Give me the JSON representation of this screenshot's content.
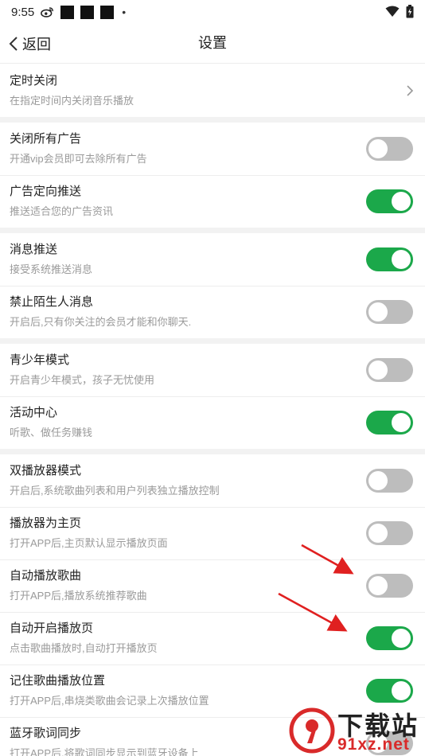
{
  "status_bar": {
    "time": "9:55"
  },
  "header": {
    "back_label": "返回",
    "title": "设置"
  },
  "settings": [
    {
      "label": "定时关闭",
      "desc": "在指定时间内关闭音乐播放",
      "control": "chevron"
    },
    {
      "separator": true
    },
    {
      "label": "关闭所有广告",
      "desc": "开通vip会员即可去除所有广告",
      "control": "toggle",
      "on": false
    },
    {
      "label": "广告定向推送",
      "desc": "推送适合您的广告资讯",
      "control": "toggle",
      "on": true
    },
    {
      "separator": true
    },
    {
      "label": "消息推送",
      "desc": "接受系统推送消息",
      "control": "toggle",
      "on": true
    },
    {
      "label": "禁止陌生人消息",
      "desc": "开启后,只有你关注的会员才能和你聊天.",
      "control": "toggle",
      "on": false
    },
    {
      "separator": true
    },
    {
      "label": "青少年模式",
      "desc": "开启青少年模式，孩子无忧使用",
      "control": "toggle",
      "on": false
    },
    {
      "label": "活动中心",
      "desc": "听歌、做任务赚钱",
      "control": "toggle",
      "on": true
    },
    {
      "separator": true
    },
    {
      "label": "双播放器模式",
      "desc": "开启后,系统歌曲列表和用户列表独立播放控制",
      "control": "toggle",
      "on": false
    },
    {
      "label": "播放器为主页",
      "desc": "打开APP后,主页默认显示播放页面",
      "control": "toggle",
      "on": false
    },
    {
      "label": "自动播放歌曲",
      "desc": "打开APP后,播放系统推荐歌曲",
      "control": "toggle",
      "on": false
    },
    {
      "label": "自动开启播放页",
      "desc": "点击歌曲播放时,自动打开播放页",
      "control": "toggle",
      "on": true
    },
    {
      "label": "记住歌曲播放位置",
      "desc": "打开APP后,串烧类歌曲会记录上次播放位置",
      "control": "toggle",
      "on": true
    },
    {
      "label": "蓝牙歌词同步",
      "desc": "打开APP后,将歌词同步显示到蓝牙设备上",
      "control": "toggle",
      "on": false
    }
  ],
  "watermark": {
    "main": "下载站",
    "sub": "91xz.net"
  },
  "colors": {
    "toggle_on": "#1ba84a",
    "toggle_off": "#bdbdbd",
    "annotation_arrow": "#e02020",
    "section_gap": "#f2f2f2"
  },
  "icons": [
    "weibo-icon",
    "wifi-icon",
    "battery-charging-icon",
    "back-chevron-icon",
    "chevron-right-icon",
    "red-arrow-annotation"
  ]
}
